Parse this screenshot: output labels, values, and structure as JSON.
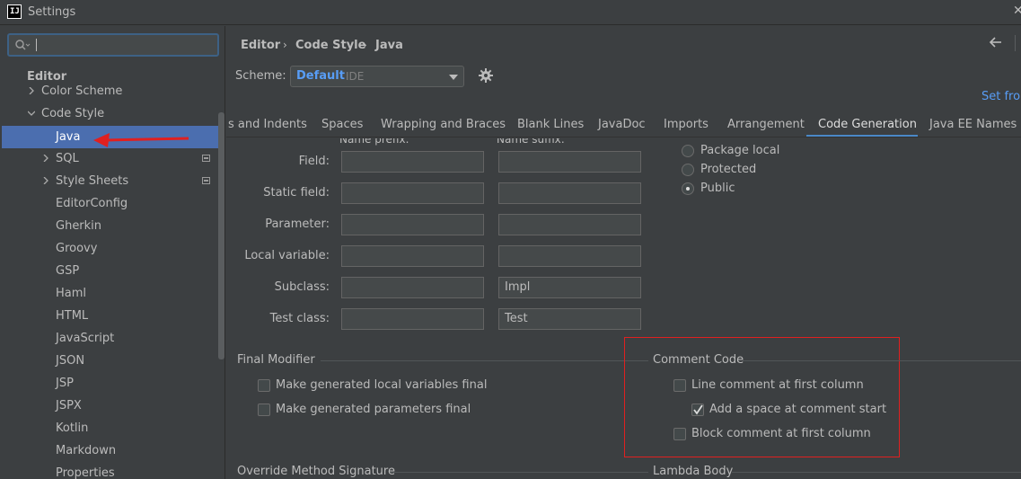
{
  "window": {
    "title": "Settings",
    "icon": "intellij-icon"
  },
  "sidebar": {
    "search_placeholder": "",
    "items": [
      {
        "label": "Editor",
        "level": 0,
        "bold": true
      },
      {
        "label": "Color Scheme",
        "level": 1,
        "chevron": "right"
      },
      {
        "label": "Code Style",
        "level": 1,
        "chevron": "down"
      },
      {
        "label": "Java",
        "level": 2,
        "selected": true
      },
      {
        "label": "SQL",
        "level": 2,
        "chevron": "right",
        "project": true
      },
      {
        "label": "Style Sheets",
        "level": 2,
        "chevron": "right",
        "project": true
      },
      {
        "label": "EditorConfig",
        "level": 2
      },
      {
        "label": "Gherkin",
        "level": 2
      },
      {
        "label": "Groovy",
        "level": 2
      },
      {
        "label": "GSP",
        "level": 2
      },
      {
        "label": "Haml",
        "level": 2
      },
      {
        "label": "HTML",
        "level": 2
      },
      {
        "label": "JavaScript",
        "level": 2
      },
      {
        "label": "JSON",
        "level": 2
      },
      {
        "label": "JSP",
        "level": 2
      },
      {
        "label": "JSPX",
        "level": 2
      },
      {
        "label": "Kotlin",
        "level": 2
      },
      {
        "label": "Markdown",
        "level": 2
      },
      {
        "label": "Properties",
        "level": 2
      }
    ]
  },
  "breadcrumb": [
    "Editor",
    "Code Style",
    "Java"
  ],
  "scheme": {
    "label": "Scheme:",
    "name": "Default",
    "type": "IDE"
  },
  "set_from": "Set from...",
  "tabs": [
    "s and Indents",
    "Spaces",
    "Wrapping and Braces",
    "Blank Lines",
    "JavaDoc",
    "Imports",
    "Arrangement",
    "Code Generation",
    "Java EE Names"
  ],
  "active_tab": "Code Generation",
  "naming": {
    "col_prefix": "Name prefix:",
    "col_suffix": "Name suffix:",
    "rows": [
      {
        "label": "Field:",
        "prefix": "",
        "suffix": ""
      },
      {
        "label": "Static field:",
        "prefix": "",
        "suffix": ""
      },
      {
        "label": "Parameter:",
        "prefix": "",
        "suffix": ""
      },
      {
        "label": "Local variable:",
        "prefix": "",
        "suffix": ""
      },
      {
        "label": "Subclass:",
        "prefix": "",
        "suffix": "Impl"
      },
      {
        "label": "Test class:",
        "prefix": "",
        "suffix": "Test"
      }
    ]
  },
  "visibility": {
    "options": [
      "Package local",
      "Protected",
      "Public"
    ],
    "selected": "Public"
  },
  "final_modifier": {
    "title": "Final Modifier",
    "options": [
      {
        "label": "Make generated local variables final",
        "checked": false
      },
      {
        "label": "Make generated parameters final",
        "checked": false
      }
    ]
  },
  "comment_code": {
    "title": "Comment Code",
    "options": [
      {
        "label": "Line comment at first column",
        "checked": false
      },
      {
        "label": "Add a space at comment start",
        "checked": true
      },
      {
        "label": "Block comment at first column",
        "checked": false
      }
    ]
  },
  "override_method_signature": {
    "title": "Override Method Signature"
  },
  "lambda_body": {
    "title": "Lambda Body"
  },
  "colors": {
    "accent": "#4b6eaf",
    "link": "#589df6",
    "highlight_box": "#e02020",
    "arrow": "#e02020"
  }
}
